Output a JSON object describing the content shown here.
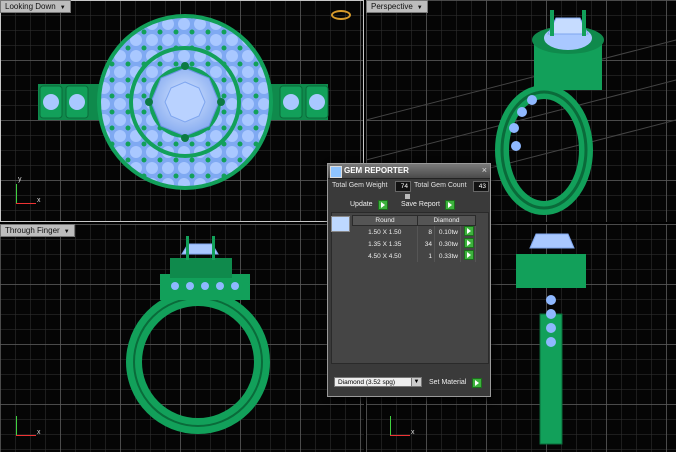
{
  "viewports": {
    "top_left_label": "Looking Down",
    "top_right_label": "Perspective",
    "bottom_left_label": "Through Finger",
    "bottom_right_label": ""
  },
  "axes": {
    "x": "x",
    "y": "y"
  },
  "gem_reporter": {
    "title": "GEM REPORTER",
    "total_weight_label": "Total Gem Weight",
    "total_weight_value": "74",
    "total_count_label": "Total Gem Count",
    "total_count_value": "43",
    "update_label": "Update",
    "save_report_label": "Save Report",
    "table": {
      "header_shape": "Round",
      "header_material": "Diamond",
      "rows": [
        {
          "size": "1.50 X 1.50",
          "count": "8",
          "weight": "0.10tw"
        },
        {
          "size": "1.35 X 1.35",
          "count": "34",
          "weight": "0.30tw"
        },
        {
          "size": "4.50 X 4.50",
          "count": "1",
          "weight": "0.33tw"
        }
      ]
    },
    "material_value": "Diamond   (3.52 spg)",
    "set_material_label": "Set Material"
  },
  "colors": {
    "metal": "#12a05a",
    "metal_dark": "#0a6b3a",
    "gem": "#8fb8ff",
    "gem_light": "#c6dcff",
    "grid": "#5a5a5a"
  }
}
